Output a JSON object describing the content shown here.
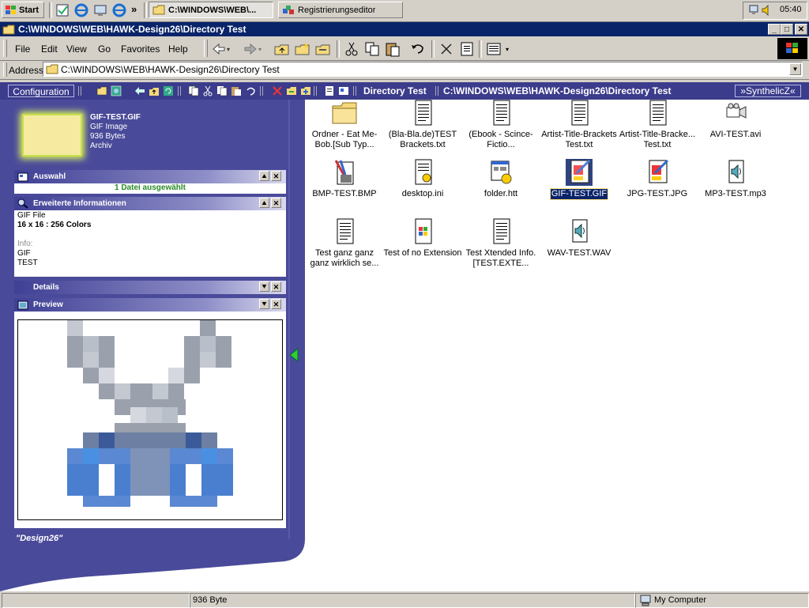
{
  "taskbar": {
    "start_label": "Start",
    "tasks": [
      {
        "label": "C:\\WINDOWS\\WEB\\..."
      },
      {
        "label": "Registrierungseditor"
      }
    ],
    "chevron": "»",
    "clock": "05:40"
  },
  "window": {
    "title": "C:\\WINDOWS\\WEB\\HAWK-Design26\\Directory Test",
    "controls": {
      "minimize": "_",
      "maximize": "□",
      "close": "✕"
    }
  },
  "menu": [
    "File",
    "Edit",
    "View",
    "Go",
    "Favorites",
    "Help"
  ],
  "address": {
    "label": "Address",
    "value": "C:\\WINDOWS\\WEB\\HAWK-Design26\\Directory Test"
  },
  "panelbar": {
    "config_label": "Configuration",
    "folder_name": "Directory Test",
    "path": "C:\\WINDOWS\\WEB\\HAWK-Design26\\Directory Test",
    "brand": "»SynthelicZ«"
  },
  "selected_file": {
    "name": "GIF-TEST.GIF",
    "type": "GIF Image",
    "size": "936 Bytes",
    "attr": "Archiv"
  },
  "sections": {
    "auswahl": {
      "title": "Auswahl",
      "text": "1 Datei ausgewählt"
    },
    "info": {
      "title": "Erweiterte Informationen",
      "file_type": "GIF File",
      "dimensions": "16 x 16 : 256 Colors",
      "info_label": "Info:",
      "info_lines": [
        "GIF",
        "TEST"
      ]
    },
    "details": {
      "title": "Details"
    },
    "preview": {
      "title": "Preview"
    }
  },
  "design_label": "\"Design26\"",
  "files": [
    {
      "name": "Ordner - Eat Me-Bob.[Sub Typ...",
      "icon": "folder-icon"
    },
    {
      "name": "(Bla-Bla.de)TEST Brackets.txt",
      "icon": "text-file-icon"
    },
    {
      "name": "(Ebook - Scince-Fictio...",
      "icon": "text-file-icon"
    },
    {
      "name": "Artist-Title-Brackets Test.txt",
      "icon": "text-file-icon"
    },
    {
      "name": "Artist-Title-Bracke... Test.txt",
      "icon": "text-file-icon"
    },
    {
      "name": "AVI-TEST.avi",
      "icon": "video-file-icon"
    },
    {
      "name": "BMP-TEST.BMP",
      "icon": "paint-file-icon"
    },
    {
      "name": "desktop.ini",
      "icon": "settings-file-icon"
    },
    {
      "name": "folder.htt",
      "icon": "template-file-icon"
    },
    {
      "name": "GIF-TEST.GIF",
      "icon": "image-file-icon",
      "selected": true
    },
    {
      "name": "JPG-TEST.JPG",
      "icon": "image-file-icon"
    },
    {
      "name": "MP3-TEST.mp3",
      "icon": "audio-file-icon"
    },
    {
      "name": "Test ganz ganz ganz wirklich se...",
      "icon": "text-file-icon"
    },
    {
      "name": "Test of no Extension",
      "icon": "windows-file-icon"
    },
    {
      "name": "Test Xtended Info.[TEST.EXTE...",
      "icon": "text-file-icon"
    },
    {
      "name": "WAV-TEST.WAV",
      "icon": "audio-file-icon"
    }
  ],
  "status": {
    "size": "936 Byte",
    "zone": "My Computer"
  },
  "colors": {
    "panel": "#4a4a9a",
    "title": "#0a246a",
    "selection": "#0a246a"
  }
}
